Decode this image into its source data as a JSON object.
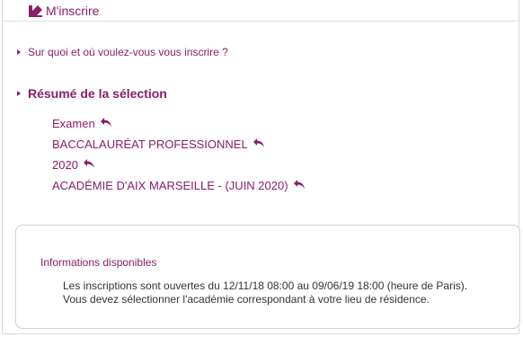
{
  "header": {
    "title": "M'inscrire",
    "icon": "arrow-down-right-icon"
  },
  "question": {
    "label": "Sur quoi et où voulez-vous vous inscrire ?"
  },
  "summary": {
    "title": "Résumé de la sélection",
    "items": [
      {
        "label": "Examen"
      },
      {
        "label": "BACCALAURÉAT PROFESSIONNEL"
      },
      {
        "label": "2020"
      },
      {
        "label": "ACADÉMIE D'AIX MARSEILLE - (JUIN 2020)"
      }
    ]
  },
  "info": {
    "title": "Informations disponibles",
    "line1": "Les inscriptions sont ouvertes du 12/11/18 08:00 au 09/06/19 18:00 (heure de Paris).",
    "line2": "Vous devez sélectionner l'académie correspondant à votre lieu de résidence."
  },
  "colors": {
    "accent": "#8a1e6a",
    "text": "#333333",
    "border": "#d0d0d0"
  }
}
